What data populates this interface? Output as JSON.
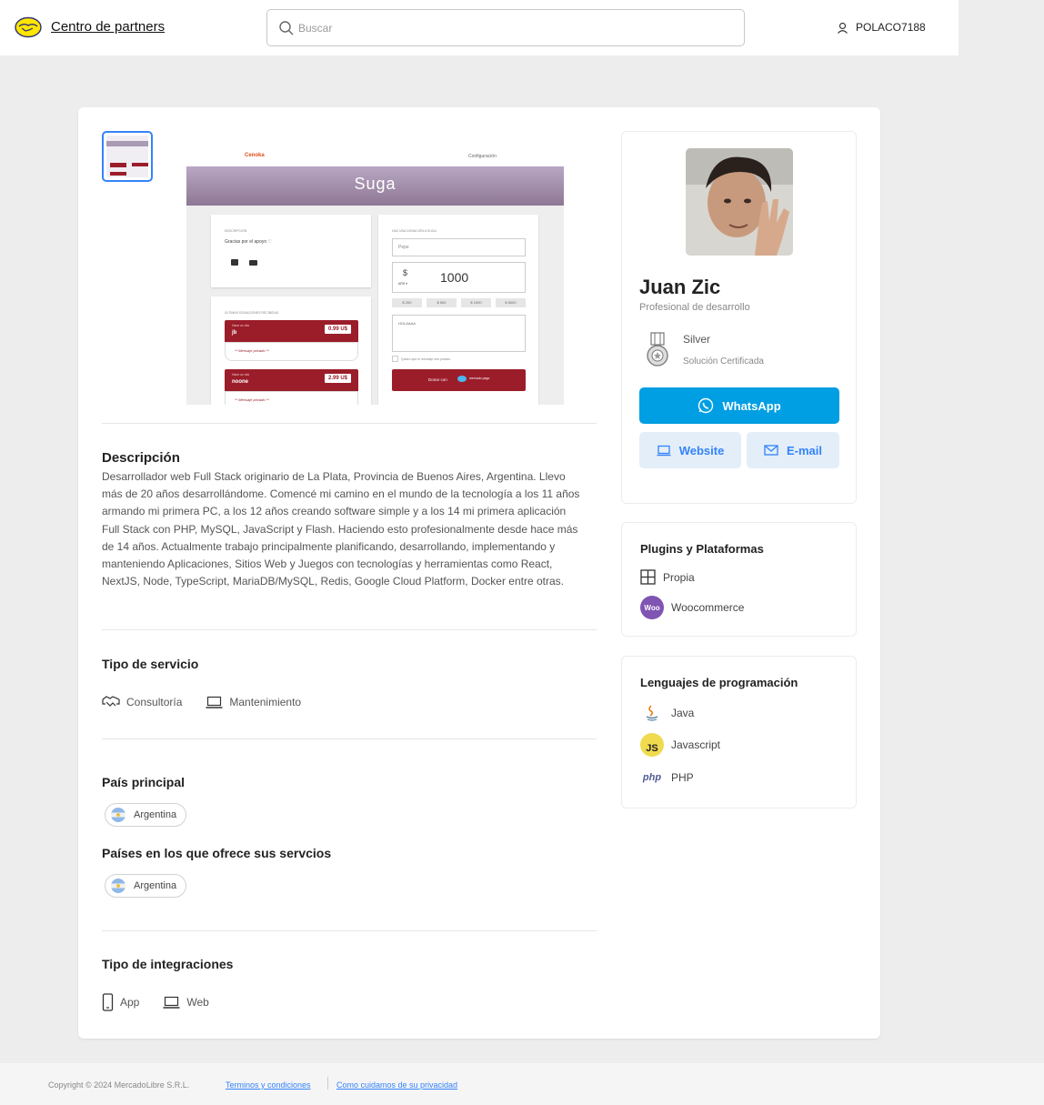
{
  "header": {
    "brand": "Centro de partners",
    "search_placeholder": "Buscar",
    "username": "POLACO7188"
  },
  "gallery": {
    "preview": {
      "logo": "Cenoka",
      "config": "Configuración",
      "banner": "Suga",
      "desc_label": "DESCRIPCIÓN",
      "desc_text": "Gracias por el apoyo ♡",
      "donate_label": "HAZ UNA DONACIÓN A SUGA",
      "name_value": "Pepe",
      "currency": "$",
      "currency_code": "ARS ▾",
      "amount": "1000",
      "chips": [
        "$ 200",
        "$ 500",
        "$ 1000",
        "$ 5000"
      ],
      "message_value": "HOLAAAA",
      "private_label": "Quiero que el mensaje sea privado",
      "donate_button": "Donar con",
      "mp_label": "mercado pago",
      "recent_label": "ÚLTIMAS DONACIONES RECIBIDAS",
      "donations": [
        {
          "time": "Hace un día",
          "name": "jb",
          "price": "0.99 U$",
          "message": "** Mensaje privado **"
        },
        {
          "time": "Hace un día",
          "name": "noone",
          "price": "2.99 U$",
          "message": "** Mensaje privado **"
        }
      ]
    }
  },
  "description": {
    "title": "Descripción",
    "body": "Desarrollador web Full Stack originario de La Plata, Provincia de Buenos Aires, Argentina. Llevo más de 20 años desarrollándome. Comencé mi camino en el mundo de la tecnología a los 11 años armando mi primera PC, a los 12 años creando software simple y a los 14 mi primera aplicación Full Stack con PHP, MySQL, JavaScript y Flash. Haciendo esto profesionalmente desde hace más de 14 años. Actualmente trabajo principalmente planificando, desarrollando, implementando y manteniendo Aplicaciones, Sitios Web y Juegos con tecnologías y herramientas como React, NextJS, Node, TypeScript, MariaDB/MySQL, Redis, Google Cloud Platform, Docker entre otras."
  },
  "service_type": {
    "title": "Tipo de servicio",
    "items": [
      "Consultoría",
      "Mantenimiento"
    ]
  },
  "main_country": {
    "title": "País principal",
    "country": "Argentina"
  },
  "service_countries": {
    "title": "Países en los que ofrece sus servcios",
    "country": "Argentina"
  },
  "integrations": {
    "title": "Tipo de integraciones",
    "items": [
      "App",
      "Web"
    ]
  },
  "profile": {
    "name": "Juan Zic",
    "role": "Profesional de desarrollo",
    "tier": "Silver",
    "tier_sub": "Solución Certificada",
    "whatsapp": "WhatsApp",
    "website": "Website",
    "email": "E-mail"
  },
  "plugins": {
    "title": "Plugins y Plataformas",
    "items": [
      "Propia",
      "Woocommerce"
    ],
    "woo_badge": "Woo"
  },
  "languages": {
    "title": "Lenguajes de programación",
    "items": [
      "Java",
      "Javascript",
      "PHP"
    ],
    "js_badge": "JS",
    "php_badge": "php"
  },
  "footer": {
    "copyright": "Copyright © 2024 MercadoLibre S.R.L.",
    "terms": "Terminos y condiciones",
    "privacy": "Como cuidamos de su privacidad"
  },
  "colors": {
    "accent": "#3483fa",
    "whatsapp_button": "#009ee3",
    "brand_yellow": "#ffe600",
    "donation_red": "#9b1d2a"
  }
}
